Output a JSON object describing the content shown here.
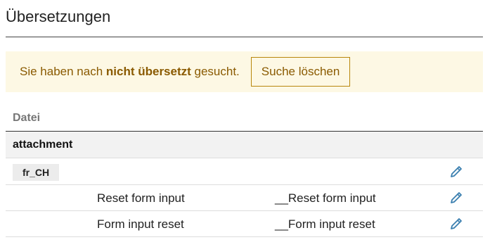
{
  "page": {
    "title": "Übersetzungen"
  },
  "notice": {
    "prefix": "Sie haben nach ",
    "term": "nicht übersetzt",
    "suffix": " gesucht.",
    "clear_label": "Suche löschen",
    "text_color": "#8a5a00",
    "background": "#fdf8e4"
  },
  "table": {
    "header": "Datei",
    "group": "attachment",
    "locale": "fr_CH",
    "rows": [
      {
        "source": "Reset form input",
        "target": "__Reset form input"
      },
      {
        "source": "Form input reset",
        "target": "__Form input reset"
      }
    ]
  },
  "icons": {
    "edit": "pencil-icon",
    "edit_color": "#3b7fb0"
  }
}
